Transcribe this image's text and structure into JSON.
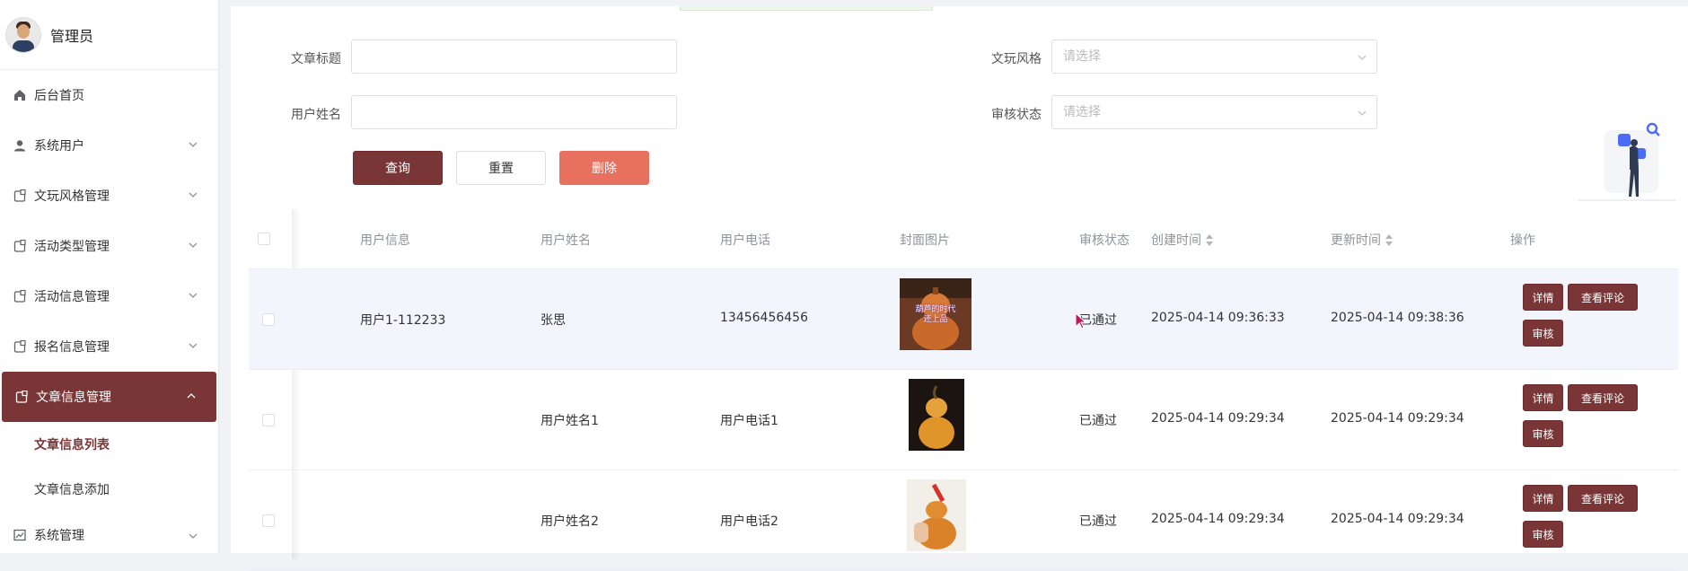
{
  "user": {
    "name": "管理员"
  },
  "sidebar": {
    "items": [
      {
        "label": "后台首页",
        "icon": "home-icon"
      },
      {
        "label": "系统用户",
        "icon": "user-icon"
      },
      {
        "label": "文玩风格管理",
        "icon": "doc-icon"
      },
      {
        "label": "活动类型管理",
        "icon": "doc-icon"
      },
      {
        "label": "活动信息管理",
        "icon": "doc-icon"
      },
      {
        "label": "报名信息管理",
        "icon": "doc-icon"
      },
      {
        "label": "文章信息管理",
        "icon": "doc-icon"
      }
    ],
    "subitems": [
      {
        "label": "文章信息列表"
      },
      {
        "label": "文章信息添加"
      }
    ],
    "last": {
      "label": "系统管理",
      "icon": "chart-icon"
    }
  },
  "filters": {
    "title_label": "文章标题",
    "username_label": "用户姓名",
    "style_label": "文玩风格",
    "style_placeholder": "请选择",
    "status_label": "审核状态",
    "status_placeholder": "请选择"
  },
  "buttons": {
    "query": "查询",
    "reset": "重置",
    "delete": "删除"
  },
  "table": {
    "headers": {
      "user_info": "用户信息",
      "user_name": "用户姓名",
      "user_phone": "用户电话",
      "cover": "封面图片",
      "status": "审核状态",
      "created": "创建时间",
      "updated": "更新时间",
      "ops": "操作"
    },
    "rows": [
      {
        "user_info": "用户1-112233",
        "user_name": "张思",
        "user_phone": "13456456456",
        "status": "已通过",
        "created": "2025-04-14 09:36:33",
        "updated": "2025-04-14 09:38:36",
        "thumb_text": "葫芦的时代\n还上品"
      },
      {
        "user_info": "",
        "user_name": "用户姓名1",
        "user_phone": "用户电话1",
        "status": "已通过",
        "created": "2025-04-14 09:29:34",
        "updated": "2025-04-14 09:29:34"
      },
      {
        "user_info": "",
        "user_name": "用户姓名2",
        "user_phone": "用户电话2",
        "status": "已通过",
        "created": "2025-04-14 09:29:34",
        "updated": "2025-04-14 09:29:34"
      }
    ],
    "ops": {
      "detail": "详情",
      "comments": "查看评论",
      "review": "审核"
    }
  },
  "colors": {
    "accent": "#7a3636",
    "danger": "#e8705e"
  }
}
